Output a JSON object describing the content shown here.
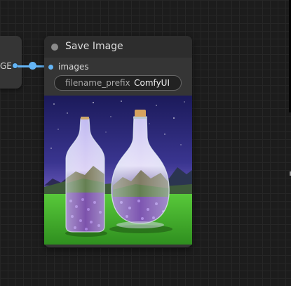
{
  "previous_node": {
    "output_label": "GE"
  },
  "node": {
    "title": "Save Image",
    "input_label": "images",
    "widget": {
      "name": "filename_prefix",
      "value": "ComfyUI"
    }
  },
  "colors": {
    "canvas_bg": "#1c1c1c",
    "node_bg": "#353535",
    "node_title_bg": "#2d2d2d",
    "link_color": "#64b5f6"
  },
  "preview_image": {
    "description": "two glass bottles containing lavender mountain landscapes on a grassy field under a starry purple sky"
  }
}
